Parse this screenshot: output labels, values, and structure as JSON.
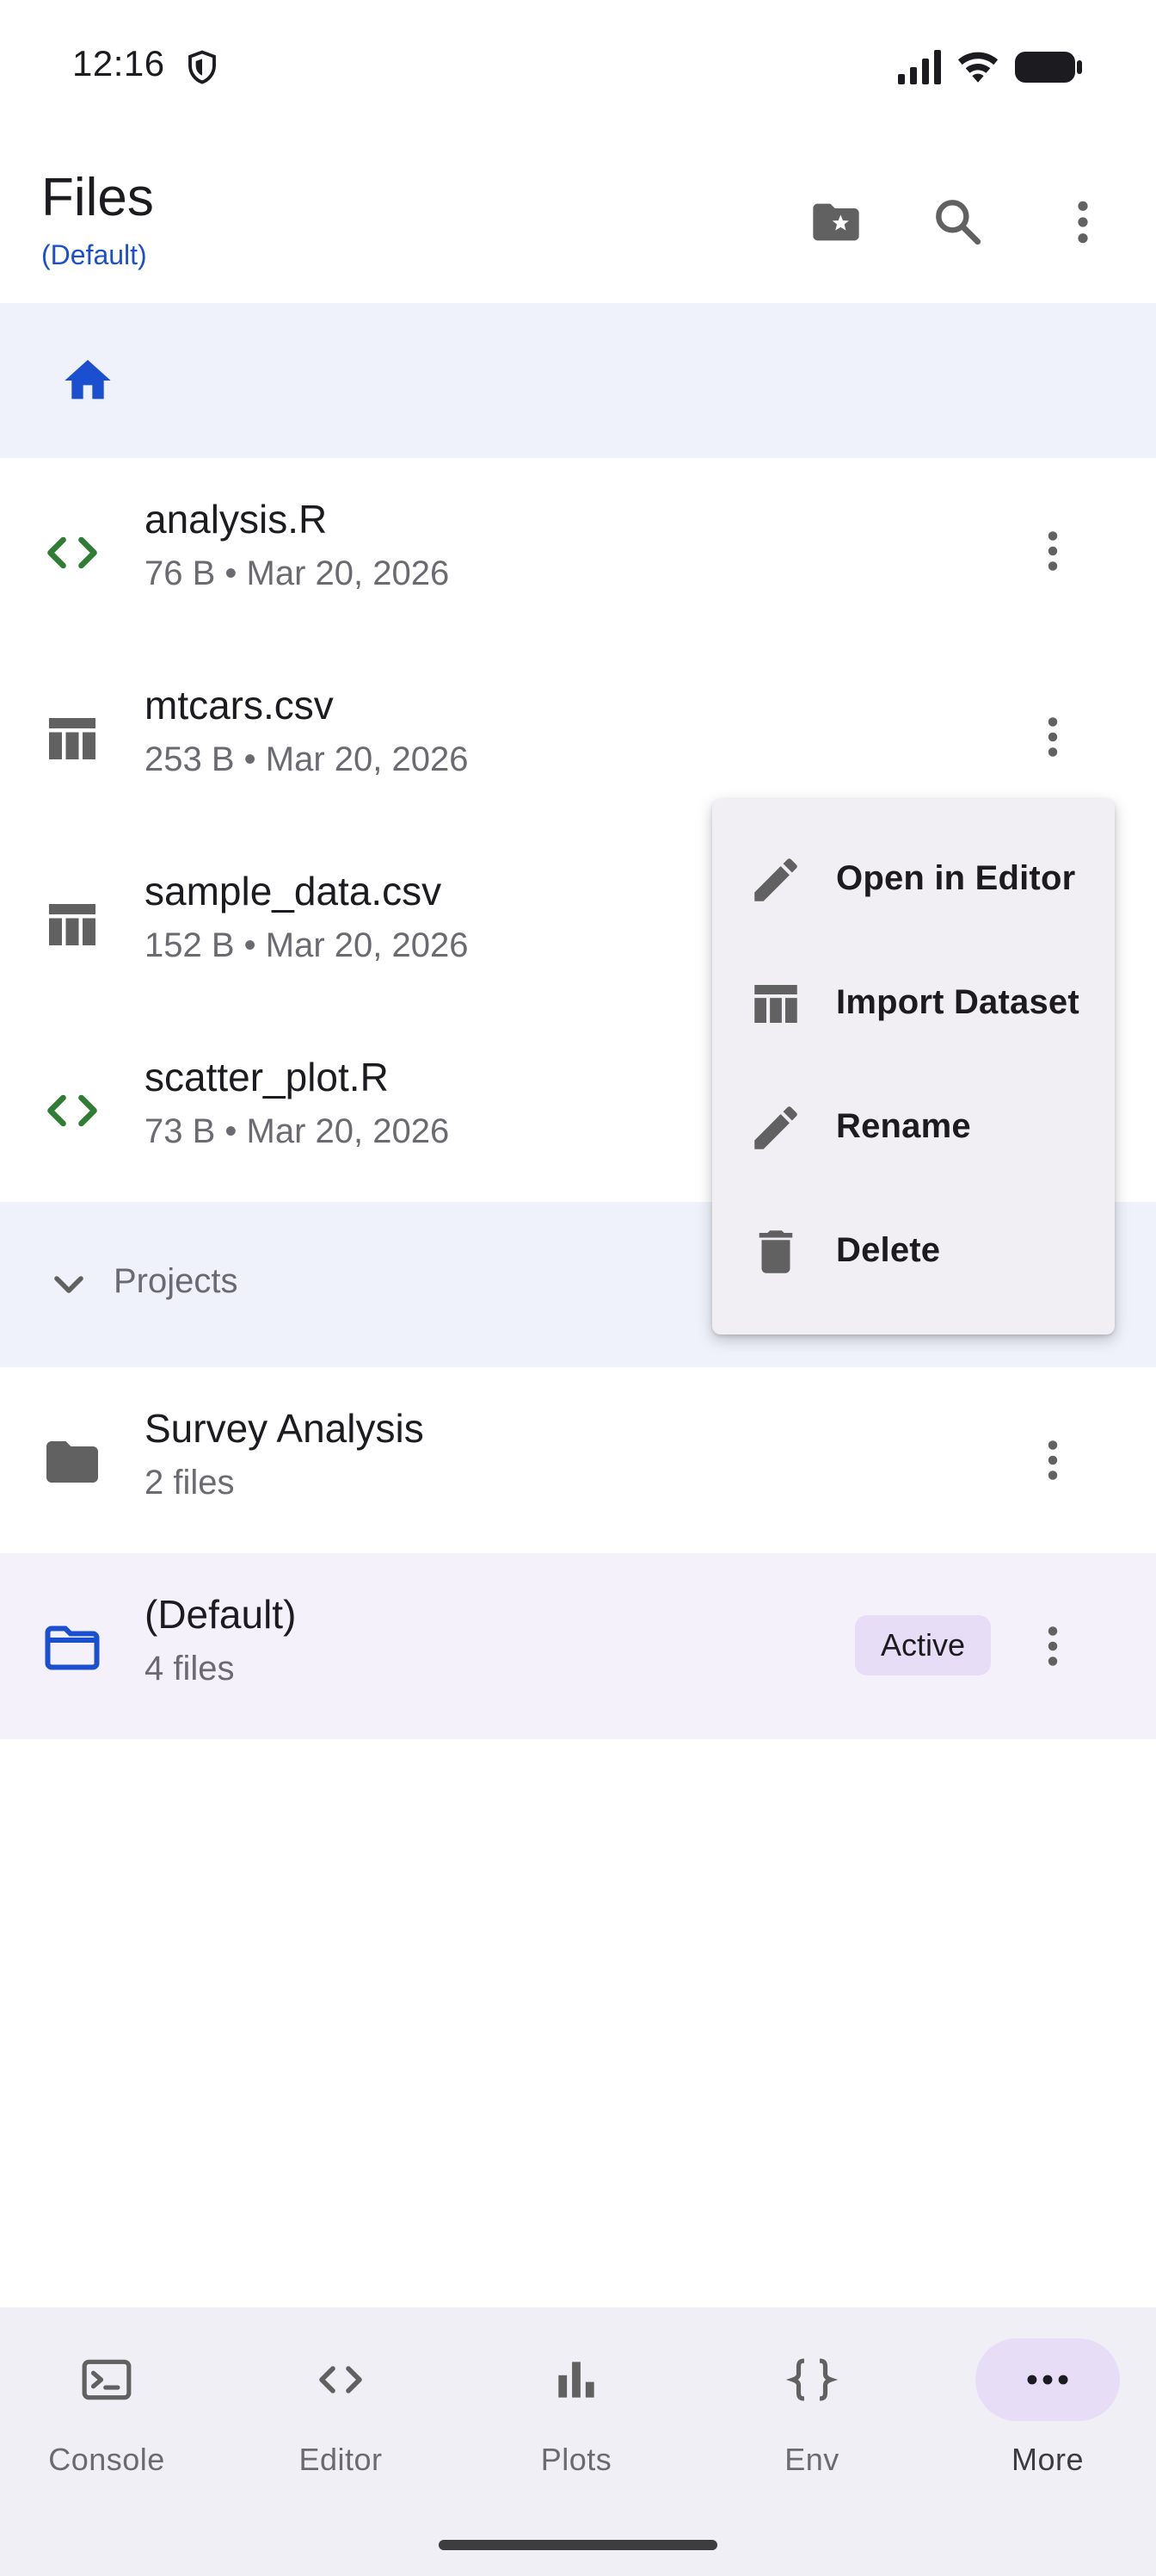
{
  "status_bar": {
    "time": "12:16",
    "icons": [
      "shield-icon",
      "signal-icon",
      "wifi-icon",
      "battery-icon"
    ]
  },
  "app_bar": {
    "title": "Files",
    "subtitle": "(Default)",
    "actions": [
      "starred-folder-icon",
      "search-icon",
      "more-vert-icon"
    ]
  },
  "breadcrumb": {
    "icon": "home-icon"
  },
  "files": [
    {
      "name": "analysis.R",
      "meta": "76 B • Mar 20, 2026",
      "icon": "code-icon"
    },
    {
      "name": "mtcars.csv",
      "meta": "253 B • Mar 20, 2026",
      "icon": "table-icon"
    },
    {
      "name": "sample_data.csv",
      "meta": "152 B • Mar 20, 2026",
      "icon": "table-icon"
    },
    {
      "name": "scatter_plot.R",
      "meta": "73 B • Mar 20, 2026",
      "icon": "code-icon"
    }
  ],
  "projects": {
    "label": "Projects",
    "items": [
      {
        "name": "Survey Analysis",
        "meta": "2 files",
        "icon": "folder-icon"
      },
      {
        "name": "(Default)",
        "meta": "4 files",
        "icon": "folder-open-icon",
        "badge": "Active"
      }
    ]
  },
  "context_menu": {
    "items": [
      {
        "label": "Open in Editor",
        "icon": "edit-icon"
      },
      {
        "label": "Import Dataset",
        "icon": "table-icon"
      },
      {
        "label": "Rename",
        "icon": "edit-icon"
      },
      {
        "label": "Delete",
        "icon": "delete-icon"
      }
    ]
  },
  "bottom_nav": {
    "items": [
      {
        "label": "Console",
        "icon": "terminal-icon"
      },
      {
        "label": "Editor",
        "icon": "code-icon"
      },
      {
        "label": "Plots",
        "icon": "bar-chart-icon"
      },
      {
        "label": "Env",
        "icon": "braces-icon"
      },
      {
        "label": "More",
        "icon": "more-horiz-icon",
        "selected": true
      }
    ]
  },
  "colors": {
    "accent_blue": "#1a4fd0",
    "code_green": "#2e7d32",
    "icon_gray": "#616161",
    "breadcrumb_bg": "#eff2fb",
    "active_bg": "#f4f1fb",
    "badge_bg": "#e7ddf6"
  }
}
